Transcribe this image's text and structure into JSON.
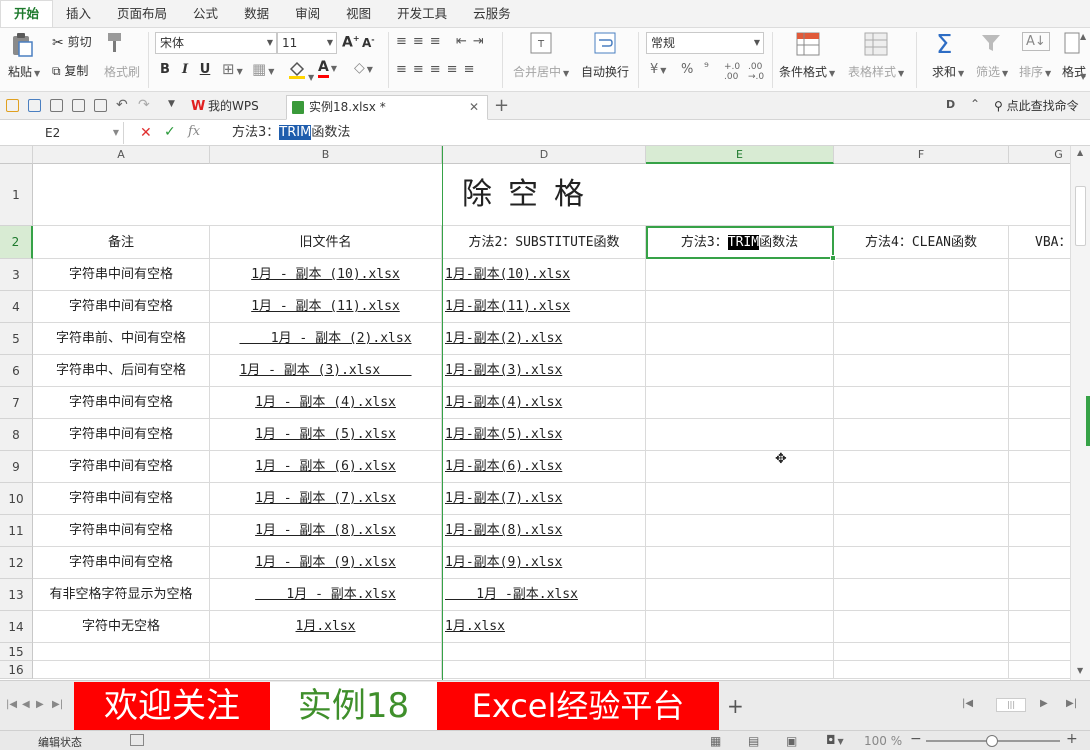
{
  "menu": {
    "tabs": [
      "开始",
      "插入",
      "页面布局",
      "公式",
      "数据",
      "审阅",
      "视图",
      "开发工具",
      "云服务"
    ],
    "active": "开始"
  },
  "ribbon": {
    "paste": "粘贴",
    "cut": "剪切",
    "copy": "复制",
    "format_painter": "格式刷",
    "font_name": "宋体",
    "font_size": "11",
    "bold": "B",
    "italic": "I",
    "underline": "U",
    "merge_center": "合并居中",
    "wrap_text": "自动换行",
    "number_format": "常规",
    "percent": "%",
    "comma": "⁹",
    "conditional_format": "条件格式",
    "table_style": "表格样式",
    "sum": "求和",
    "filter": "筛选",
    "sort": "排序",
    "format": "格式"
  },
  "docbar": {
    "tabs": [
      {
        "label": "我的WPS",
        "active": false
      },
      {
        "label": "实例18.xlsx *",
        "active": true
      }
    ],
    "find_command": "点此查找命令"
  },
  "formula_bar": {
    "name_box": "E2",
    "fx": "fx",
    "content_prefix": "方法3：",
    "content_highlight": "TRIM",
    "content_suffix": "函数法"
  },
  "grid": {
    "columns": [
      "A",
      "B",
      "D",
      "E",
      "F",
      "G"
    ],
    "selected_column": "E",
    "title": "除空格",
    "headers": {
      "a": "备注",
      "b": "旧文件名",
      "d": "方法2：SUBSTITUTE函数",
      "e_prefix": "方法3：",
      "e_highlight": "TRIM",
      "e_suffix": "函数法",
      "f": "方法4：CLEAN函数",
      "g": "VBA："
    },
    "rows": [
      {
        "num": "3",
        "a": "字符串中间有空格",
        "b": "1月 - 副本 (10).xlsx",
        "d": "1月-副本(10).xlsx"
      },
      {
        "num": "4",
        "a": "字符串中间有空格",
        "b": "1月 - 副本 (11).xlsx",
        "d": "1月-副本(11).xlsx"
      },
      {
        "num": "5",
        "a": "字符串前、中间有空格",
        "b": "    1月 - 副本 (2).xlsx",
        "d": "1月-副本(2).xlsx"
      },
      {
        "num": "6",
        "a": "字符串中、后间有空格",
        "b": "1月 - 副本 (3).xlsx    ",
        "d": "1月-副本(3).xlsx"
      },
      {
        "num": "7",
        "a": "字符串中间有空格",
        "b": "1月 - 副本 (4).xlsx",
        "d": "1月-副本(4).xlsx"
      },
      {
        "num": "8",
        "a": "字符串中间有空格",
        "b": "1月 - 副本 (5).xlsx",
        "d": "1月-副本(5).xlsx"
      },
      {
        "num": "9",
        "a": "字符串中间有空格",
        "b": "1月 - 副本 (6).xlsx",
        "d": "1月-副本(6).xlsx"
      },
      {
        "num": "10",
        "a": "字符串中间有空格",
        "b": "1月 - 副本 (7).xlsx",
        "d": "1月-副本(7).xlsx"
      },
      {
        "num": "11",
        "a": "字符串中间有空格",
        "b": "1月 - 副本 (8).xlsx",
        "d": "1月-副本(8).xlsx"
      },
      {
        "num": "12",
        "a": "字符串中间有空格",
        "b": "1月 - 副本 (9).xlsx",
        "d": "1月-副本(9).xlsx"
      },
      {
        "num": "13",
        "a": "有非空格字符显示为空格",
        "b": "    1月 - 副本.xlsx",
        "d": "    1月 -副本.xlsx"
      },
      {
        "num": "14",
        "a": "字符中无空格",
        "b": "1月.xlsx",
        "d": "1月.xlsx"
      }
    ],
    "row_numbers_top": [
      "1",
      "2"
    ],
    "row_numbers_bottom": [
      "15",
      "16"
    ]
  },
  "sheet_tabs": {
    "tabs": [
      {
        "label": "欢迎关注",
        "style": "red"
      },
      {
        "label": "实例18",
        "style": "active"
      },
      {
        "label": "Excel经验平台",
        "style": "red"
      }
    ],
    "add": "+"
  },
  "status": {
    "mode": "编辑状态",
    "zoom": "100 %"
  },
  "colors": {
    "accent_green": "#36a247",
    "tab_red": "#ff0000",
    "highlight_blue": "#1f5dad"
  }
}
